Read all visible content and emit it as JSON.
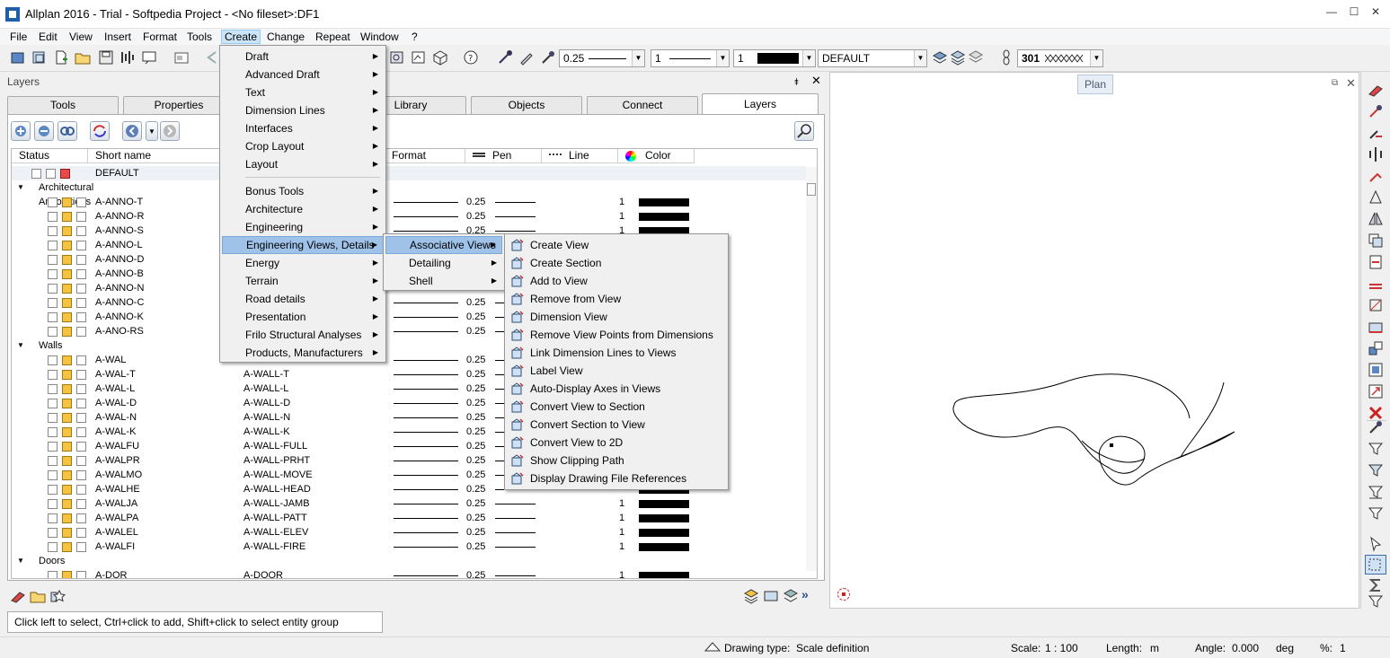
{
  "window": {
    "title": "Allplan 2016 - Trial - Softpedia Project - <No fileset>:DF1",
    "minimize": "—",
    "maximize": "☐",
    "close": "✕"
  },
  "menubar": [
    {
      "label": "File"
    },
    {
      "label": "Edit"
    },
    {
      "label": "View"
    },
    {
      "label": "Insert"
    },
    {
      "label": "Format"
    },
    {
      "label": "Tools"
    },
    {
      "label": "Create"
    },
    {
      "label": "Change"
    },
    {
      "label": "Repeat"
    },
    {
      "label": "Window"
    },
    {
      "label": "?"
    }
  ],
  "toolbar": {
    "pen_value": "0.25",
    "line_value": "1",
    "color_value": "1",
    "layer_value": "DEFAULT",
    "hatch_value": "301"
  },
  "layers_panel": {
    "title": "Layers",
    "pin": "⯒",
    "close": "✕",
    "tabs": [
      "Tools",
      "Properties",
      "Library",
      "Objects",
      "Connect",
      "Layers"
    ],
    "columns": {
      "status": "Status",
      "short_name": "Short name",
      "format": "Format",
      "pen": "Pen",
      "line": "Line",
      "color": "Color"
    }
  },
  "layers": {
    "default_row": {
      "short": "DEFAULT"
    },
    "groups": [
      {
        "name": "Architectural Annotations",
        "rows": [
          {
            "short": "A-ANNO-T",
            "name": "",
            "pen": "0.25",
            "line": "1"
          },
          {
            "short": "A-ANNO-R",
            "name": "",
            "pen": "0.25",
            "line": "1"
          },
          {
            "short": "A-ANNO-S",
            "name": "",
            "pen": "0.25",
            "line": "1"
          },
          {
            "short": "A-ANNO-L",
            "name": "",
            "pen": "",
            "line": ""
          },
          {
            "short": "A-ANNO-D",
            "name": "",
            "pen": "",
            "line": ""
          },
          {
            "short": "A-ANNO-B",
            "name": "",
            "pen": "",
            "line": ""
          },
          {
            "short": "A-ANNO-N",
            "name": "",
            "pen": "",
            "line": ""
          },
          {
            "short": "A-ANNO-C",
            "name": "",
            "pen": "0.25",
            "line": ""
          },
          {
            "short": "A-ANNO-K",
            "name": "",
            "pen": "0.25",
            "line": ""
          },
          {
            "short": "A-ANO-RS",
            "name": "",
            "pen": "0.25",
            "line": ""
          }
        ]
      },
      {
        "name": "Walls",
        "rows": [
          {
            "short": "A-WAL",
            "name": "",
            "pen": "0.25",
            "line": ""
          },
          {
            "short": "A-WAL-T",
            "name": "A-WALL-T",
            "pen": "0.25",
            "line": ""
          },
          {
            "short": "A-WAL-L",
            "name": "A-WALL-L",
            "pen": "0.25",
            "line": ""
          },
          {
            "short": "A-WAL-D",
            "name": "A-WALL-D",
            "pen": "0.25",
            "line": ""
          },
          {
            "short": "A-WAL-N",
            "name": "A-WALL-N",
            "pen": "0.25",
            "line": ""
          },
          {
            "short": "A-WAL-K",
            "name": "A-WALL-K",
            "pen": "0.25",
            "line": ""
          },
          {
            "short": "A-WALFU",
            "name": "A-WALL-FULL",
            "pen": "0.25",
            "line": ""
          },
          {
            "short": "A-WALPR",
            "name": "A-WALL-PRHT",
            "pen": "0.25",
            "line": ""
          },
          {
            "short": "A-WALMO",
            "name": "A-WALL-MOVE",
            "pen": "0.25",
            "line": ""
          },
          {
            "short": "A-WALHE",
            "name": "A-WALL-HEAD",
            "pen": "0.25",
            "line": ""
          },
          {
            "short": "A-WALJA",
            "name": "A-WALL-JAMB",
            "pen": "0.25",
            "line": "1"
          },
          {
            "short": "A-WALPA",
            "name": "A-WALL-PATT",
            "pen": "0.25",
            "line": "1"
          },
          {
            "short": "A-WALEL",
            "name": "A-WALL-ELEV",
            "pen": "0.25",
            "line": "1"
          },
          {
            "short": "A-WALFI",
            "name": "A-WALL-FIRE",
            "pen": "0.25",
            "line": "1"
          }
        ]
      },
      {
        "name": "Doors",
        "rows": [
          {
            "short": "A-DOR",
            "name": "A-DOOR",
            "pen": "0.25",
            "line": "1"
          }
        ]
      }
    ]
  },
  "create_menu": [
    {
      "label": "Draft",
      "sub": true
    },
    {
      "label": "Advanced Draft",
      "sub": true
    },
    {
      "label": "Text",
      "sub": true
    },
    {
      "label": "Dimension Lines",
      "sub": true
    },
    {
      "label": "Interfaces",
      "sub": true
    },
    {
      "label": "Crop Layout",
      "sub": true
    },
    {
      "label": "Layout",
      "sub": true
    },
    {
      "label": "Bonus Tools",
      "sub": true
    },
    {
      "label": "Architecture",
      "sub": true
    },
    {
      "label": "Engineering",
      "sub": true
    },
    {
      "label": "Engineering Views, Details",
      "sub": true
    },
    {
      "label": "Energy",
      "sub": true
    },
    {
      "label": "Terrain",
      "sub": true
    },
    {
      "label": "Road details",
      "sub": true
    },
    {
      "label": "Presentation",
      "sub": true
    },
    {
      "label": "Frilo Structural Analyses",
      "sub": true
    },
    {
      "label": "Products, Manufacturers",
      "sub": true
    }
  ],
  "eng_views_menu": [
    {
      "label": "Associative Views"
    },
    {
      "label": "Detailing"
    },
    {
      "label": "Shell"
    }
  ],
  "assoc_views_menu": [
    {
      "label": "Create View",
      "icon": "create-view-icon"
    },
    {
      "label": "Create Section",
      "icon": "create-section-icon"
    },
    {
      "label": "Add to View",
      "icon": "add-to-view-icon"
    },
    {
      "label": "Remove from View",
      "icon": "remove-from-view-icon"
    },
    {
      "label": "Dimension View",
      "icon": "dimension-view-icon"
    },
    {
      "label": "Remove View Points from Dimensions",
      "icon": "remove-view-points-icon"
    },
    {
      "label": "Link Dimension Lines to Views",
      "icon": "link-dimension-lines-icon"
    },
    {
      "label": "Label View",
      "icon": "label-view-icon"
    },
    {
      "label": "Auto-Display Axes in Views",
      "icon": "auto-display-axes-icon"
    },
    {
      "label": "Convert View to Section",
      "icon": "convert-view-to-section-icon"
    },
    {
      "label": "Convert Section to View",
      "icon": "convert-section-to-view-icon"
    },
    {
      "label": "Convert View to 2D",
      "icon": "convert-view-to-2d-icon"
    },
    {
      "label": "Show Clipping Path",
      "icon": "show-clipping-path-icon"
    },
    {
      "label": "Display Drawing File References",
      "icon": "display-drawing-file-references-icon"
    }
  ],
  "plan": {
    "label": "Plan"
  },
  "prompt": "Click left to select, Ctrl+click to add, Shift+click to select entity group",
  "statusbar": {
    "drawing_type_label": "Drawing type:",
    "drawing_type_value": "Scale definition",
    "scale_label": "Scale:",
    "scale_value": "1 : 100",
    "length_label": "Length:",
    "length_value": "m",
    "angle_label": "Angle:",
    "angle_value": "0.000",
    "angle_unit": "deg",
    "percent_label": "%:",
    "percent_value": "1"
  }
}
